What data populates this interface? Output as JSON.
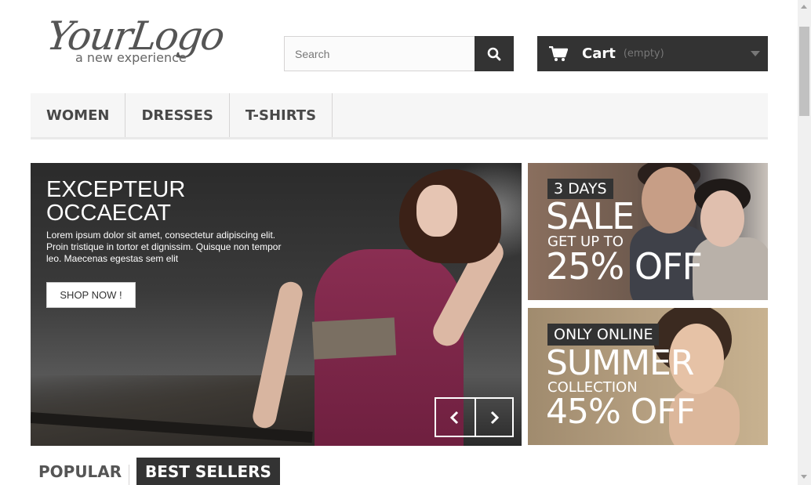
{
  "header": {
    "logo": {
      "script": "YourLogo",
      "tagline": "a new experience"
    },
    "search": {
      "placeholder": "Search",
      "value": "",
      "icon": "search-icon"
    },
    "cart": {
      "label": "Cart",
      "status": "(empty)",
      "icon": "shopping-cart-icon"
    }
  },
  "nav": {
    "items": [
      {
        "label": "WOMEN"
      },
      {
        "label": "DRESSES"
      },
      {
        "label": "T-SHIRTS"
      }
    ]
  },
  "slider": {
    "title": "EXCEPTEUR OCCAECAT",
    "text": "Lorem ipsum dolor sit amet, consectetur adipiscing elit. Proin tristique in tortor et dignissim. Quisque non tempor leo. Maecenas egestas sem elit",
    "button": "SHOP NOW !",
    "prev_icon": "chevron-left-icon",
    "next_icon": "chevron-right-icon"
  },
  "banners": [
    {
      "tag": "3 DAYS",
      "headline": "SALE",
      "sub": "GET UP TO",
      "offer": "25% OFF"
    },
    {
      "tag": "ONLY ONLINE",
      "headline": "SUMMER",
      "sub": "COLLECTION",
      "offer": "45% OFF"
    }
  ],
  "tabs": [
    {
      "label": "POPULAR",
      "active": false
    },
    {
      "label": "BEST SELLERS",
      "active": true
    }
  ],
  "colors": {
    "dark": "#333333",
    "nav_bg": "#f6f6f6",
    "border": "#d6d4d4",
    "dress": "#8a2e52"
  }
}
